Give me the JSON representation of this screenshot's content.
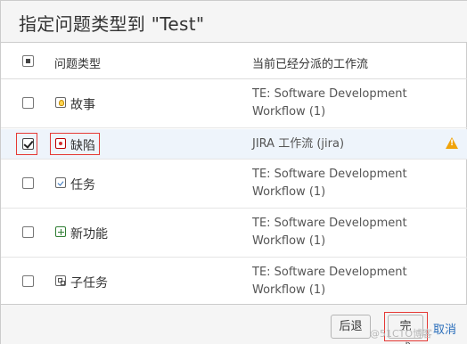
{
  "dialog": {
    "title": "指定问题类型到 \"Test\""
  },
  "table": {
    "headers": {
      "issue_type": "问题类型",
      "workflow": "当前已经分派的工作流"
    },
    "rows": [
      {
        "type": "故事",
        "icon": "story-icon",
        "checked": false,
        "workflow_line1": "TE: Software Development",
        "workflow_line2": "Workflow (1)"
      },
      {
        "type": "缺陷",
        "icon": "bug-icon",
        "checked": true,
        "workflow_line1": "JIRA 工作流 (jira)",
        "workflow_line2": "",
        "warning": true
      },
      {
        "type": "任务",
        "icon": "task-icon",
        "checked": false,
        "workflow_line1": "TE: Software Development",
        "workflow_line2": "Workflow (1)"
      },
      {
        "type": "新功能",
        "icon": "new-feature-icon",
        "checked": false,
        "workflow_line1": "TE: Software Development",
        "workflow_line2": "Workflow (1)"
      },
      {
        "type": "子任务",
        "icon": "subtask-icon",
        "checked": false,
        "workflow_line1": "TE: Software Development",
        "workflow_line2": "Workflow (1)"
      }
    ]
  },
  "footer": {
    "back_label": "后退",
    "done_label": "完成",
    "cancel_label": "取消",
    "watermark": "@51CTO博客"
  },
  "colors": {
    "highlight_red": "#e53935",
    "warning_orange": "#f0a30a",
    "link_blue": "#2a6ebb",
    "selected_row_bg": "#eef4fb"
  }
}
